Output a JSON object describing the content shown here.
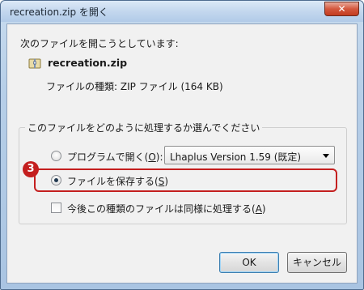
{
  "window": {
    "title": "recreation.zip を開く",
    "close_glyph": "✕"
  },
  "dialog": {
    "intro": "次のファイルを開こうとしています:",
    "file_name": "recreation.zip",
    "file_icon": "zip-file-icon",
    "file_type": "ファイルの種類: ZIP ファイル (164 KB)",
    "group_legend": "このファイルをどのように処理するか選んでください",
    "open_with_label": "プログラムで開く(",
    "open_with_accel": "O",
    "open_with_suffix": "):",
    "program_selected": "Lhaplus Version 1.59 (既定)",
    "save_label": "ファイルを保存する(",
    "save_accel": "S",
    "save_suffix": ")",
    "selected_option": "save",
    "always_label": "今後この種類のファイルは同様に処理する(",
    "always_accel": "A",
    "always_suffix": ")",
    "always_checked": false
  },
  "annotation": {
    "step_number": "3",
    "color": "#c41f1f"
  },
  "buttons": {
    "ok": "OK",
    "cancel": "キャンセル"
  }
}
